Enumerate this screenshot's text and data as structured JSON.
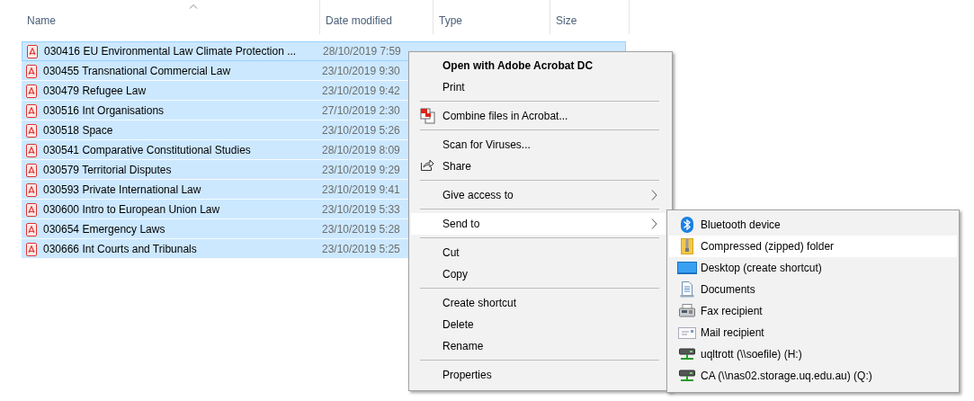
{
  "columns": [
    {
      "label": "Name",
      "sorted": true
    },
    {
      "label": "Date modified",
      "sorted": false
    },
    {
      "label": "Type",
      "sorted": false
    },
    {
      "label": "Size",
      "sorted": false
    }
  ],
  "files": [
    {
      "name": "030416 EU Environmental Law Climate Protection ...",
      "date": "28/10/2019 7:59",
      "selected": true,
      "focused": true
    },
    {
      "name": "030455 Transnational Commercial Law",
      "date": "23/10/2019 9:30",
      "selected": true,
      "focused": false
    },
    {
      "name": "030479 Refugee Law",
      "date": "23/10/2019 9:42",
      "selected": true,
      "focused": false
    },
    {
      "name": "030516 Int Organisations",
      "date": "27/10/2019 2:30",
      "selected": true,
      "focused": false
    },
    {
      "name": "030518 Space",
      "date": "23/10/2019 5:26",
      "selected": true,
      "focused": false
    },
    {
      "name": "030541 Comparative Constitutional Studies",
      "date": "28/10/2019 8:09",
      "selected": true,
      "focused": false
    },
    {
      "name": "030579 Territorial Disputes",
      "date": "23/10/2019 9:29",
      "selected": true,
      "focused": false
    },
    {
      "name": "030593 Private International Law",
      "date": "23/10/2019 9:41",
      "selected": true,
      "focused": false
    },
    {
      "name": "030600 Intro to European Union Law",
      "date": "23/10/2019 5:33",
      "selected": true,
      "focused": false
    },
    {
      "name": "030654 Emergency Laws",
      "date": "23/10/2019 5:28",
      "selected": true,
      "focused": false
    },
    {
      "name": "030666 Int Courts and Tribunals",
      "date": "23/10/2019 5:25",
      "selected": true,
      "focused": false
    }
  ],
  "context_menu": [
    {
      "kind": "item",
      "label": "Open with Adobe Acrobat DC",
      "bold": true,
      "submenu": false,
      "selected": false
    },
    {
      "kind": "item",
      "label": "Print",
      "bold": false,
      "submenu": false,
      "selected": false
    },
    {
      "kind": "separator"
    },
    {
      "kind": "item",
      "label": "Combine files in Acrobat...",
      "bold": false,
      "submenu": false,
      "selected": false
    },
    {
      "kind": "separator"
    },
    {
      "kind": "item",
      "label": "Scan for Viruses...",
      "bold": false,
      "submenu": false,
      "selected": false
    },
    {
      "kind": "item",
      "label": "Share",
      "bold": false,
      "submenu": false,
      "selected": false
    },
    {
      "kind": "separator"
    },
    {
      "kind": "item",
      "label": "Give access to",
      "bold": false,
      "submenu": true,
      "selected": false
    },
    {
      "kind": "separator"
    },
    {
      "kind": "item",
      "label": "Send to",
      "bold": false,
      "submenu": true,
      "selected": true
    },
    {
      "kind": "separator"
    },
    {
      "kind": "item",
      "label": "Cut",
      "bold": false,
      "submenu": false,
      "selected": false
    },
    {
      "kind": "item",
      "label": "Copy",
      "bold": false,
      "submenu": false,
      "selected": false
    },
    {
      "kind": "separator"
    },
    {
      "kind": "item",
      "label": "Create shortcut",
      "bold": false,
      "submenu": false,
      "selected": false
    },
    {
      "kind": "item",
      "label": "Delete",
      "bold": false,
      "submenu": false,
      "selected": false
    },
    {
      "kind": "item",
      "label": "Rename",
      "bold": false,
      "submenu": false,
      "selected": false
    },
    {
      "kind": "separator"
    },
    {
      "kind": "item",
      "label": "Properties",
      "bold": false,
      "submenu": false,
      "selected": false
    }
  ],
  "send_to_menu": [
    {
      "label": "Bluetooth device",
      "selected": false
    },
    {
      "label": "Compressed (zipped) folder",
      "selected": true
    },
    {
      "label": "Desktop (create shortcut)",
      "selected": false
    },
    {
      "label": "Documents",
      "selected": false
    },
    {
      "label": "Fax recipient",
      "selected": false
    },
    {
      "label": "Mail recipient",
      "selected": false
    },
    {
      "label": "uqltrott (\\\\soefile) (H:)",
      "selected": false
    },
    {
      "label": "CA (\\\\nas02.storage.uq.edu.au) (Q:)",
      "selected": false
    }
  ]
}
